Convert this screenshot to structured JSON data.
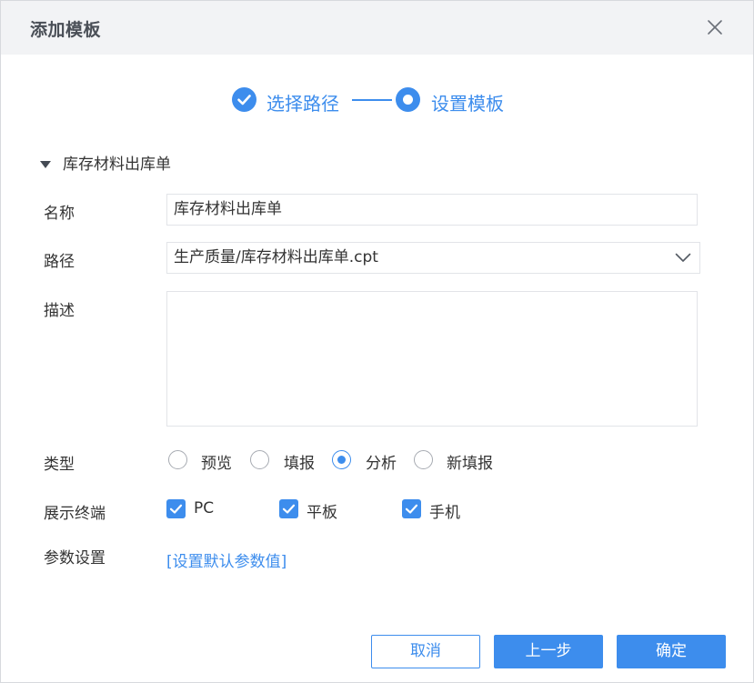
{
  "dialog": {
    "title": "添加模板",
    "close_icon": "close-icon"
  },
  "steps": [
    {
      "label": "选择路径",
      "state": "done",
      "icon": "check-icon"
    },
    {
      "label": "设置模板",
      "state": "current",
      "icon": "dot-icon"
    }
  ],
  "section": {
    "title": "库存材料出库单",
    "toggle_icon": "caret-down-icon"
  },
  "form": {
    "name": {
      "label": "名称",
      "value": "库存材料出库单"
    },
    "path": {
      "label": "路径",
      "value": "生产质量/库存材料出库单.cpt",
      "icon": "chevron-down-icon"
    },
    "description": {
      "label": "描述",
      "value": ""
    },
    "type": {
      "label": "类型",
      "options": [
        {
          "label": "预览",
          "checked": false
        },
        {
          "label": "填报",
          "checked": false
        },
        {
          "label": "分析",
          "checked": true
        },
        {
          "label": "新填报",
          "checked": false
        }
      ]
    },
    "terminals": {
      "label": "展示终端",
      "options": [
        {
          "label": "PC",
          "checked": true
        },
        {
          "label": "平板",
          "checked": true
        },
        {
          "label": "手机",
          "checked": true
        }
      ]
    },
    "params": {
      "label": "参数设置",
      "link": "[设置默认参数值]"
    }
  },
  "buttons": {
    "cancel": "取消",
    "prev": "上一步",
    "ok": "确定"
  },
  "colors": {
    "accent": "#3d8ded",
    "header_bg": "#f2f3f5",
    "border": "#e2e4e8",
    "text": "#333333"
  }
}
